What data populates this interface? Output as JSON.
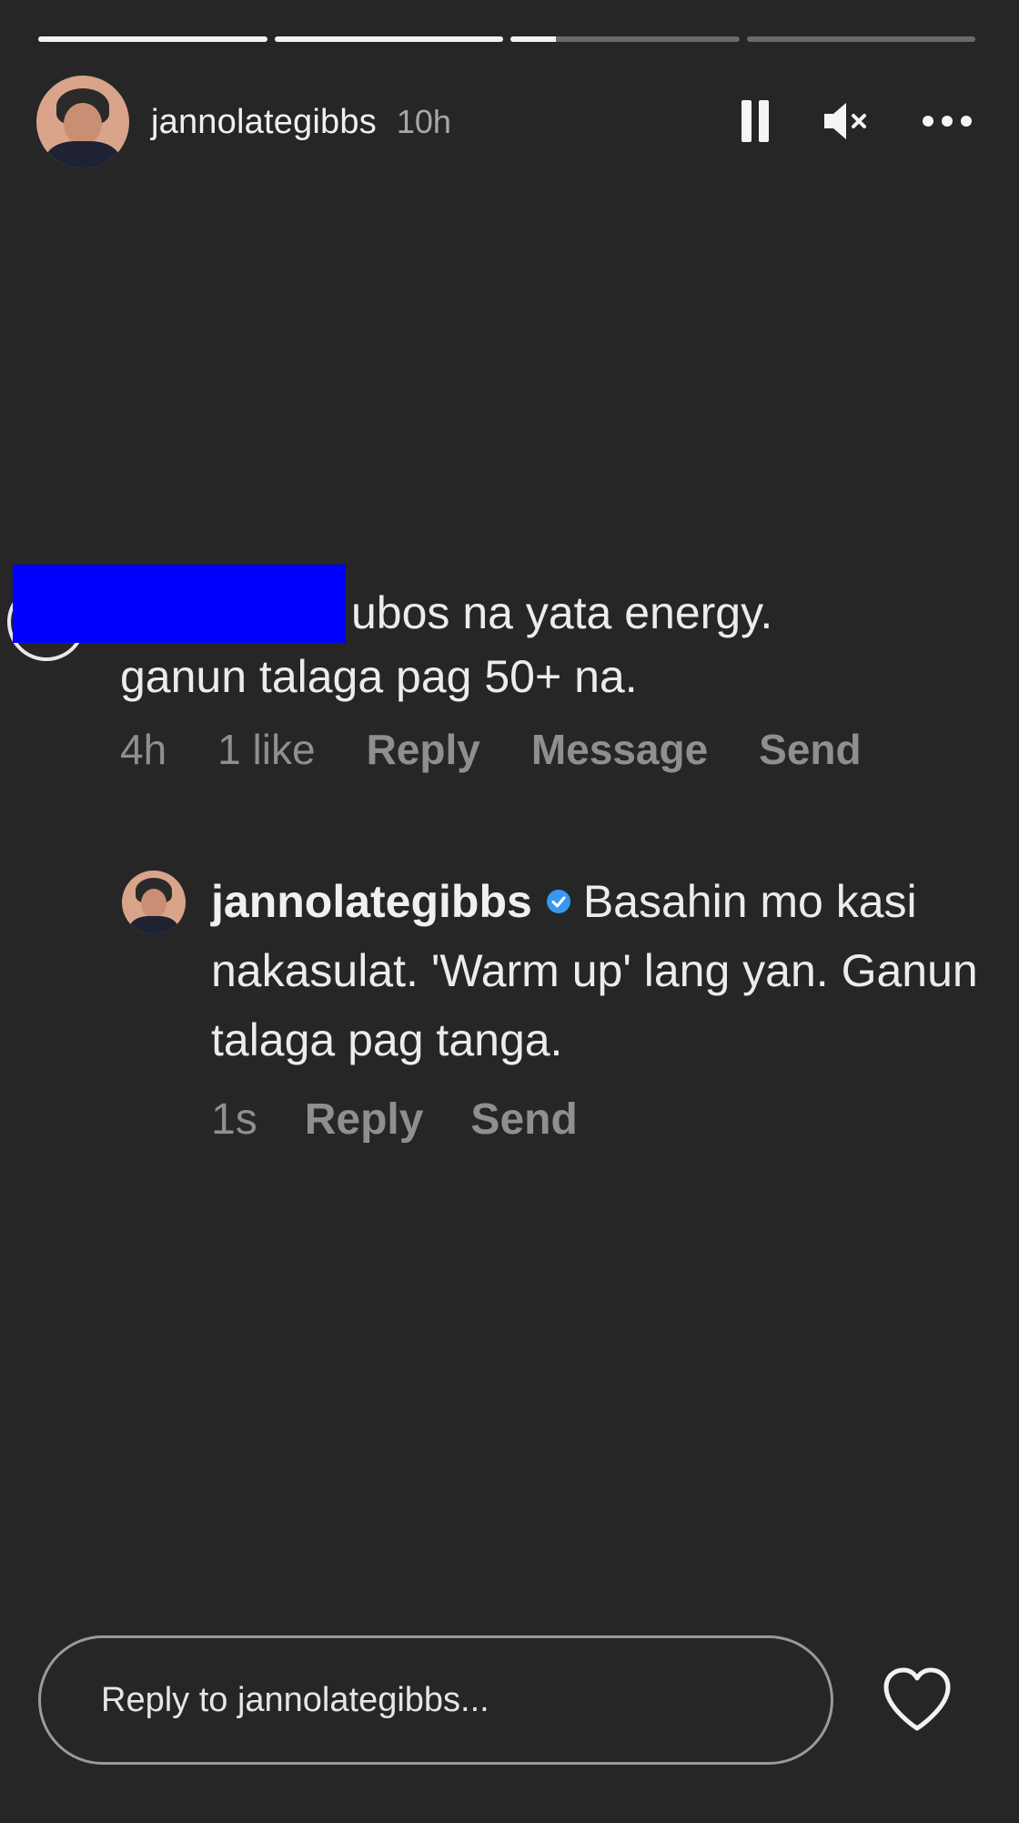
{
  "story": {
    "progress": [
      1.0,
      1.0,
      0.2,
      0.0
    ],
    "username": "jannolategibbs",
    "time": "10h"
  },
  "header_icons": [
    "pause-icon",
    "mute-icon",
    "more-icon"
  ],
  "comment": {
    "text_first": "ubos na yata energy.",
    "text_second": "ganun talaga pag 50+ na.",
    "time": "4h",
    "likes": "1 like",
    "reply_label": "Reply",
    "message_label": "Message",
    "send_label": "Send"
  },
  "reply": {
    "username": "jannolategibbs",
    "text": "Basahin mo kasi nakasulat. 'Warm up' lang yan. Ganun talaga pag tanga.",
    "time": "1s",
    "reply_label": "Reply",
    "send_label": "Send",
    "verified_color": "#3897f0"
  },
  "reply_bar": {
    "placeholder": "Reply to jannolategibbs..."
  },
  "colors": {
    "background": "#262626",
    "redaction": "#0000ff"
  }
}
